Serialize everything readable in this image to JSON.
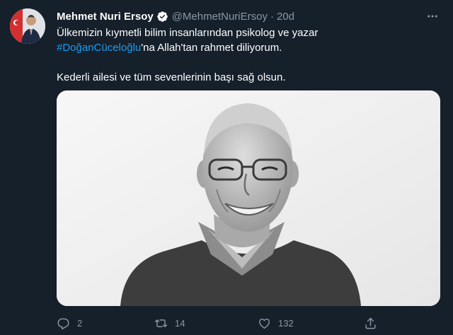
{
  "tweet": {
    "author": {
      "name": "Mehmet Nuri Ersoy",
      "handle": "@MehmetNuriErsoy",
      "verified": true
    },
    "time": "20d",
    "text": {
      "line1": "Ülkemizin kıymetli bilim insanlarından psikolog ve yazar",
      "hashtag": "#DoğanCüceloğlu",
      "line2_rest": "'na Allah'tan rahmet diliyorum.",
      "line3": "Kederli ailesi ve tüm sevenlerinin başı sağ olsun."
    },
    "stats": {
      "replies": "2",
      "retweets": "14",
      "likes": "132"
    }
  },
  "colors": {
    "background": "#15202b",
    "text": "#ffffff",
    "secondary": "#8b98a5",
    "accent": "#1d9bf0"
  },
  "icons": {
    "verified": "verified-badge-icon",
    "more": "more-dots-icon",
    "reply": "reply-icon",
    "retweet": "retweet-icon",
    "like": "heart-icon",
    "share": "share-icon"
  }
}
